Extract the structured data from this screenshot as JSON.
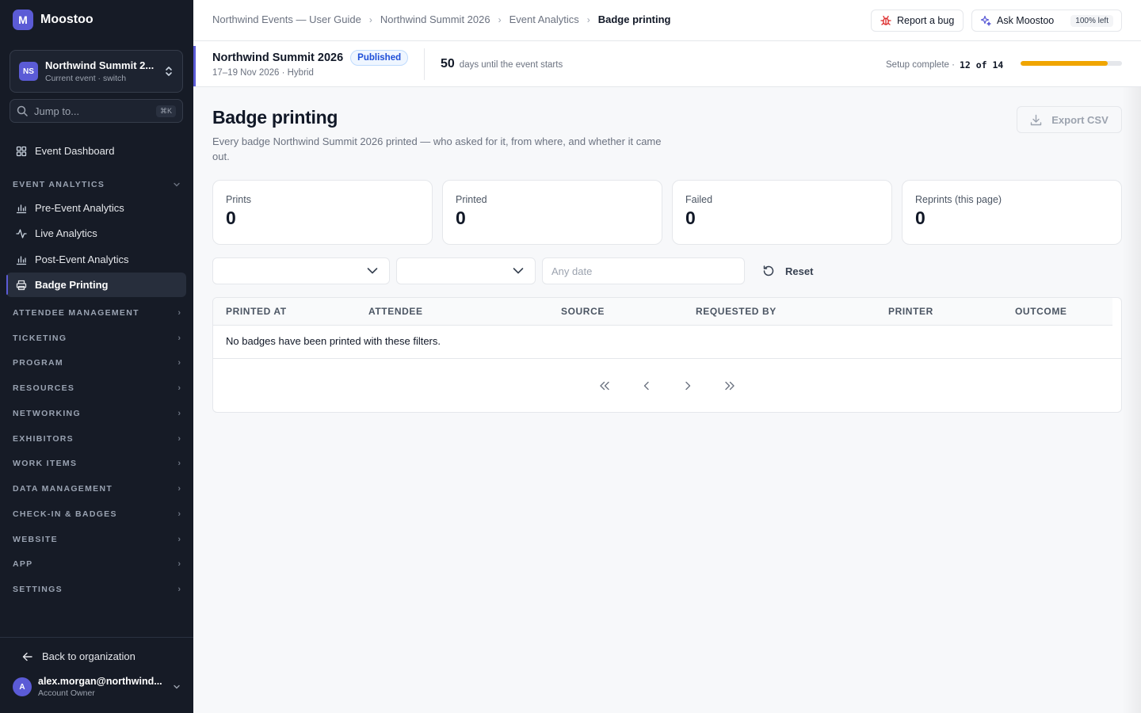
{
  "app": {
    "name": "Moostoo",
    "logo_letter": "M"
  },
  "event_switcher": {
    "initials": "NS",
    "name": "Northwind Summit 2...",
    "subtitle": "Current event · switch"
  },
  "jump": {
    "placeholder": "Jump to...",
    "shortcut": "⌘K"
  },
  "sidebar": {
    "dashboard": {
      "label": "Event Dashboard",
      "icon": "grid-icon"
    },
    "event_analytics": {
      "heading": "EVENT ANALYTICS",
      "items": [
        {
          "label": "Pre-Event Analytics",
          "icon": "bar-chart-icon"
        },
        {
          "label": "Live Analytics",
          "icon": "activity-icon"
        },
        {
          "label": "Post-Event Analytics",
          "icon": "bar-chart-icon"
        },
        {
          "label": "Badge Printing",
          "icon": "printer-icon",
          "active": true
        }
      ]
    },
    "sections": [
      "ATTENDEE MANAGEMENT",
      "TICKETING",
      "PROGRAM",
      "RESOURCES",
      "NETWORKING",
      "EXHIBITORS",
      "WORK ITEMS",
      "DATA MANAGEMENT",
      "CHECK-IN & BADGES",
      "WEBSITE",
      "APP",
      "SETTINGS"
    ],
    "back_label": "Back to organization",
    "user": {
      "initial": "A",
      "email": "alex.morgan@northwind...",
      "role": "Account Owner"
    }
  },
  "breadcrumb": [
    "Northwind Events — User Guide",
    "Northwind Summit 2026",
    "Event Analytics",
    "Badge printing"
  ],
  "topbar": {
    "report_bug": "Report a bug",
    "ask": "Ask Moostoo",
    "ask_badge": "100% left"
  },
  "event_header": {
    "name": "Northwind Summit 2026",
    "status": "Published",
    "dates": "17–19 Nov 2026 · Hybrid",
    "days_count": "50",
    "days_text": "days until the event starts",
    "setup_label": "Setup complete ·",
    "setup_count": "12 of 14",
    "setup_progress": 0.857
  },
  "page": {
    "title": "Badge printing",
    "description": "Every badge Northwind Summit 2026 printed — who asked for it, from where, and whether it came out.",
    "export_label": "Export CSV"
  },
  "stats": [
    {
      "label": "Prints",
      "value": "0"
    },
    {
      "label": "Printed",
      "value": "0"
    },
    {
      "label": "Failed",
      "value": "0"
    },
    {
      "label": "Reprints (this page)",
      "value": "0"
    }
  ],
  "filters": {
    "date_placeholder": "Any date",
    "reset_label": "Reset"
  },
  "table": {
    "columns": [
      "PRINTED AT",
      "ATTENDEE",
      "SOURCE",
      "REQUESTED BY",
      "PRINTER",
      "OUTCOME"
    ],
    "empty_message": "No badges have been printed with these filters."
  },
  "colors": {
    "accent": "#5b5bd6",
    "sidebar_bg": "#161b26",
    "progress": "#f0a500",
    "published": "#1d4ed8"
  }
}
